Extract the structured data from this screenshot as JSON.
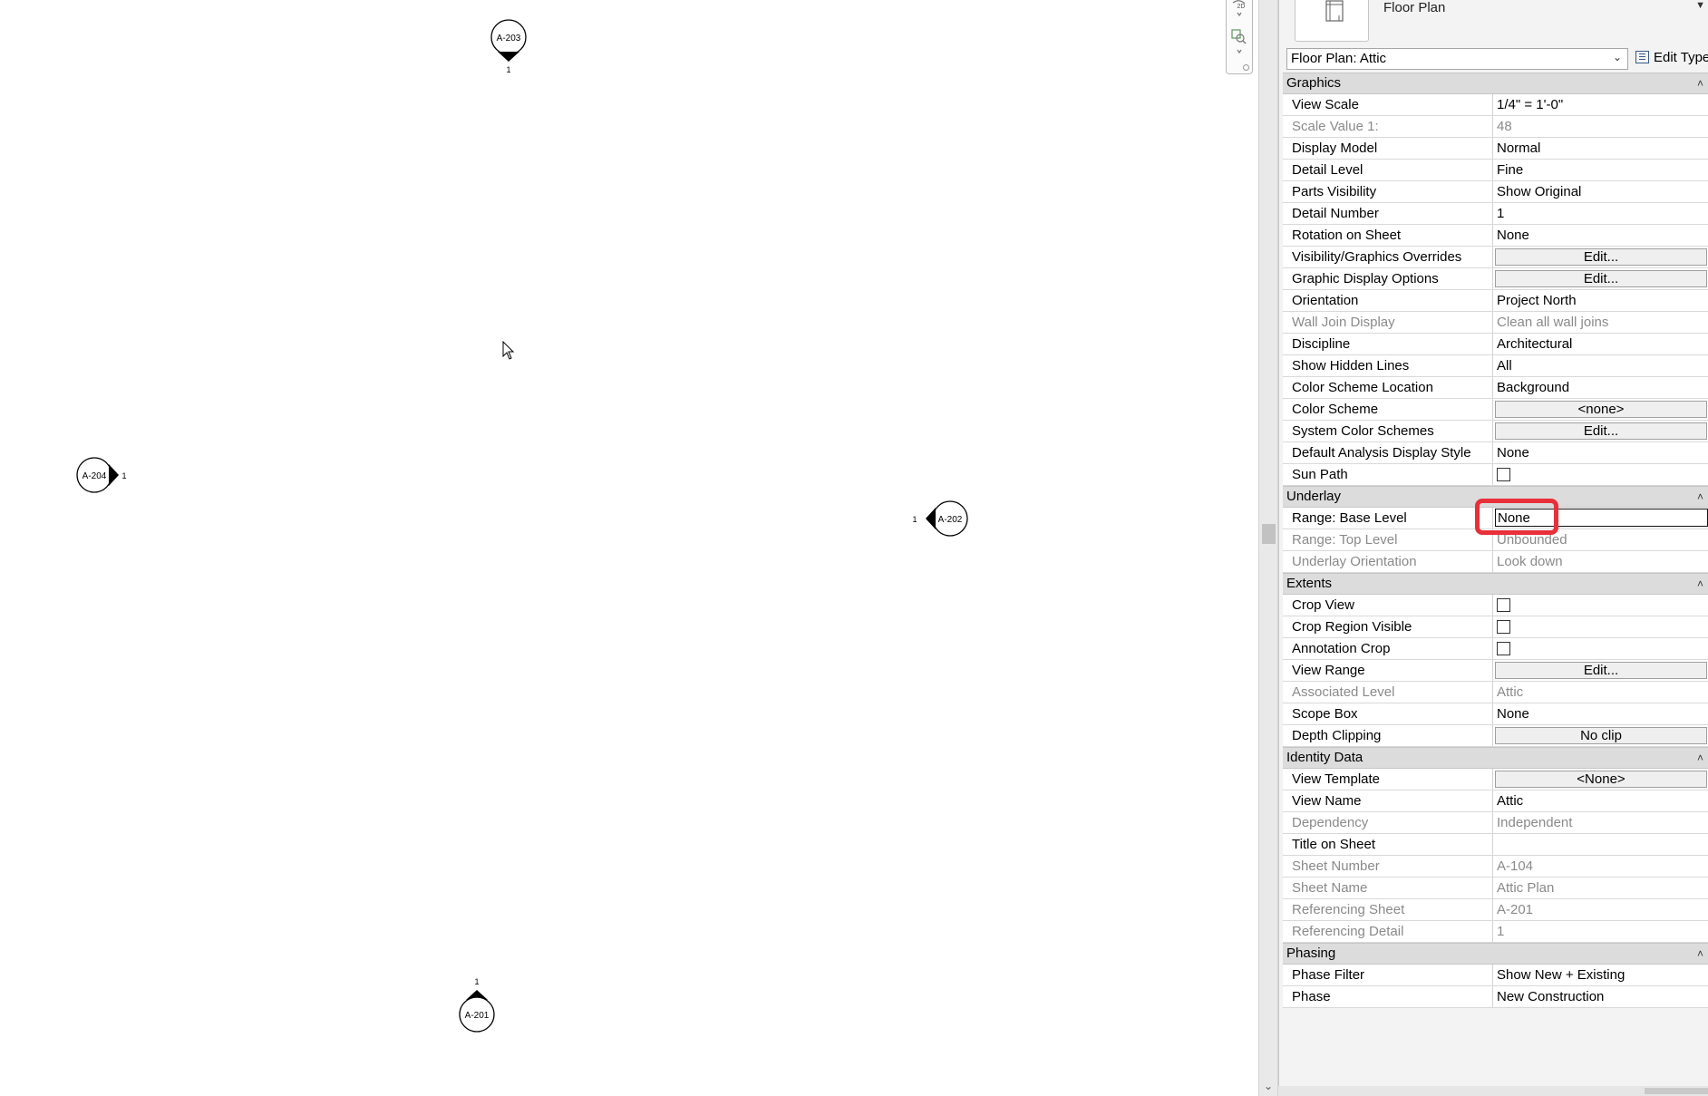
{
  "canvas": {
    "callouts": [
      {
        "id": "A-203",
        "label": "A-203",
        "detail": "1",
        "direction": "down"
      },
      {
        "id": "A-204",
        "label": "A-204",
        "detail": "1",
        "direction": "right"
      },
      {
        "id": "A-202",
        "label": "A-202",
        "detail": "1",
        "direction": "left"
      },
      {
        "id": "A-201",
        "label": "A-201",
        "detail": "1",
        "direction": "up"
      }
    ]
  },
  "navbar": {
    "zoom_label": "2D"
  },
  "properties": {
    "type_selector": {
      "family": "Floor Plan"
    },
    "instance_selector": {
      "value": "Floor Plan: Attic"
    },
    "edit_type_label": "Edit Type",
    "groups": [
      {
        "name": "Graphics",
        "params": [
          {
            "name": "View Scale",
            "value": "1/4\" = 1'-0\"",
            "kind": "text"
          },
          {
            "name": "Scale Value    1:",
            "value": "48",
            "kind": "readonly"
          },
          {
            "name": "Display Model",
            "value": "Normal",
            "kind": "text"
          },
          {
            "name": "Detail Level",
            "value": "Fine",
            "kind": "text"
          },
          {
            "name": "Parts Visibility",
            "value": "Show Original",
            "kind": "text"
          },
          {
            "name": "Detail Number",
            "value": "1",
            "kind": "text"
          },
          {
            "name": "Rotation on Sheet",
            "value": "None",
            "kind": "text"
          },
          {
            "name": "Visibility/Graphics Overrides",
            "value": "Edit...",
            "kind": "button"
          },
          {
            "name": "Graphic Display Options",
            "value": "Edit...",
            "kind": "button"
          },
          {
            "name": "Orientation",
            "value": "Project North",
            "kind": "text"
          },
          {
            "name": "Wall Join Display",
            "value": "Clean all wall joins",
            "kind": "readonly"
          },
          {
            "name": "Discipline",
            "value": "Architectural",
            "kind": "text"
          },
          {
            "name": "Show Hidden Lines",
            "value": "All",
            "kind": "text"
          },
          {
            "name": "Color Scheme Location",
            "value": "Background",
            "kind": "text"
          },
          {
            "name": "Color Scheme",
            "value": "<none>",
            "kind": "button"
          },
          {
            "name": "System Color Schemes",
            "value": "Edit...",
            "kind": "button"
          },
          {
            "name": "Default Analysis Display Style",
            "value": "None",
            "kind": "text"
          },
          {
            "name": "Sun Path",
            "value": "",
            "kind": "checkbox",
            "checked": false
          }
        ]
      },
      {
        "name": "Underlay",
        "params": [
          {
            "name": "Range: Base Level",
            "value": "None",
            "kind": "editing"
          },
          {
            "name": "Range: Top Level",
            "value": "Unbounded",
            "kind": "readonly"
          },
          {
            "name": "Underlay Orientation",
            "value": "Look down",
            "kind": "readonly"
          }
        ]
      },
      {
        "name": "Extents",
        "params": [
          {
            "name": "Crop View",
            "value": "",
            "kind": "checkbox",
            "checked": false
          },
          {
            "name": "Crop Region Visible",
            "value": "",
            "kind": "checkbox",
            "checked": false
          },
          {
            "name": "Annotation Crop",
            "value": "",
            "kind": "checkbox",
            "checked": false
          },
          {
            "name": "View Range",
            "value": "Edit...",
            "kind": "button"
          },
          {
            "name": "Associated Level",
            "value": "Attic",
            "kind": "readonly"
          },
          {
            "name": "Scope Box",
            "value": "None",
            "kind": "text"
          },
          {
            "name": "Depth Clipping",
            "value": "No clip",
            "kind": "button"
          }
        ]
      },
      {
        "name": "Identity Data",
        "params": [
          {
            "name": "View Template",
            "value": "<None>",
            "kind": "button"
          },
          {
            "name": "View Name",
            "value": "Attic",
            "kind": "text"
          },
          {
            "name": "Dependency",
            "value": "Independent",
            "kind": "readonly"
          },
          {
            "name": "Title on Sheet",
            "value": "",
            "kind": "text"
          },
          {
            "name": "Sheet Number",
            "value": "A-104",
            "kind": "readonly"
          },
          {
            "name": "Sheet Name",
            "value": "Attic Plan",
            "kind": "readonly"
          },
          {
            "name": "Referencing Sheet",
            "value": "A-201",
            "kind": "readonly"
          },
          {
            "name": "Referencing Detail",
            "value": "1",
            "kind": "readonly"
          }
        ]
      },
      {
        "name": "Phasing",
        "params": [
          {
            "name": "Phase Filter",
            "value": "Show New + Existing",
            "kind": "text"
          },
          {
            "name": "Phase",
            "value": "New Construction",
            "kind": "text"
          }
        ]
      }
    ]
  },
  "colors": {
    "highlight": "#e8303a",
    "group_header_bg": "#dcdcdc",
    "readonly_text": "#8a8a8a"
  }
}
